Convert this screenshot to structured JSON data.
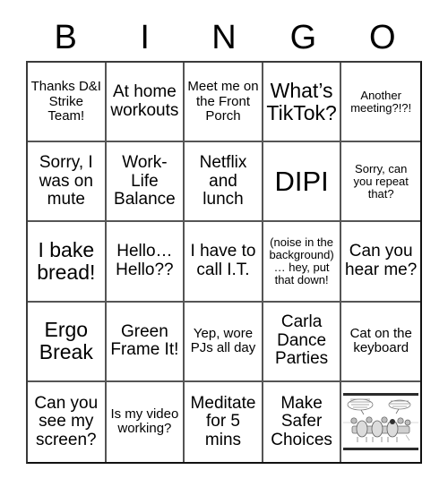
{
  "card": {
    "title": "BINGO",
    "header_letters": [
      "B",
      "I",
      "N",
      "G",
      "O"
    ],
    "grid_size": "5x5",
    "colors": {
      "background": "#ffffff",
      "text": "#000000",
      "grid_line": "#555555",
      "grid_border": "#111111"
    },
    "cells": [
      {
        "id": "b1",
        "column": "B",
        "row": 1,
        "text": "Thanks D&I Strike Team!",
        "size": "sm",
        "type": "text"
      },
      {
        "id": "i1",
        "column": "I",
        "row": 1,
        "text": "At home workouts",
        "size": "md",
        "type": "text"
      },
      {
        "id": "n1",
        "column": "N",
        "row": 1,
        "text": "Meet me on the Front Porch",
        "size": "sm",
        "type": "text"
      },
      {
        "id": "g1",
        "column": "G",
        "row": 1,
        "text": "What’s TikTok?",
        "size": "lg",
        "type": "text"
      },
      {
        "id": "o1",
        "column": "O",
        "row": 1,
        "text": "Another meeting?!?!",
        "size": "xs",
        "type": "text"
      },
      {
        "id": "b2",
        "column": "B",
        "row": 2,
        "text": "Sorry, I was on mute",
        "size": "md",
        "type": "text"
      },
      {
        "id": "i2",
        "column": "I",
        "row": 2,
        "text": "Work-Life Balance",
        "size": "md",
        "type": "text"
      },
      {
        "id": "n2",
        "column": "N",
        "row": 2,
        "text": "Netflix and lunch",
        "size": "md",
        "type": "text"
      },
      {
        "id": "g2",
        "column": "G",
        "row": 2,
        "text": "DIPI",
        "size": "xl",
        "type": "text"
      },
      {
        "id": "o2",
        "column": "O",
        "row": 2,
        "text": "Sorry, can you repeat that?",
        "size": "xs",
        "type": "text"
      },
      {
        "id": "b3",
        "column": "B",
        "row": 3,
        "text": "I bake bread!",
        "size": "lg",
        "type": "text"
      },
      {
        "id": "i3",
        "column": "I",
        "row": 3,
        "text": "Hello… Hello??",
        "size": "md",
        "type": "text"
      },
      {
        "id": "n3",
        "column": "N",
        "row": 3,
        "text": "I have to call I.T.",
        "size": "md",
        "type": "text"
      },
      {
        "id": "g3",
        "column": "G",
        "row": 3,
        "text": "(noise in the background) … hey, put that down!",
        "size": "xs",
        "type": "text"
      },
      {
        "id": "o3",
        "column": "O",
        "row": 3,
        "text": "Can you hear me?",
        "size": "md",
        "type": "text"
      },
      {
        "id": "b4",
        "column": "B",
        "row": 4,
        "text": "Ergo Break",
        "size": "lg",
        "type": "text"
      },
      {
        "id": "i4",
        "column": "I",
        "row": 4,
        "text": "Green Frame It!",
        "size": "md",
        "type": "text"
      },
      {
        "id": "n4",
        "column": "N",
        "row": 4,
        "text": "Yep, wore PJs all day",
        "size": "sm",
        "type": "text"
      },
      {
        "id": "g4",
        "column": "G",
        "row": 4,
        "text": "Carla Dance Parties",
        "size": "md",
        "type": "text"
      },
      {
        "id": "o4",
        "column": "O",
        "row": 4,
        "text": "Cat on the keyboard",
        "size": "sm",
        "type": "text"
      },
      {
        "id": "b5",
        "column": "B",
        "row": 5,
        "text": "Can you see my screen?",
        "size": "md",
        "type": "text"
      },
      {
        "id": "i5",
        "column": "I",
        "row": 5,
        "text": "Is my video working?",
        "size": "sm",
        "type": "text"
      },
      {
        "id": "n5",
        "column": "N",
        "row": 5,
        "text": "Meditate for 5 mins",
        "size": "md",
        "type": "text"
      },
      {
        "id": "g5",
        "column": "G",
        "row": 5,
        "text": "Make Safer Choices",
        "size": "md",
        "type": "text"
      },
      {
        "id": "o5",
        "column": "O",
        "row": 5,
        "text": "",
        "size": "sm",
        "type": "image",
        "image_name": "meeting-cartoon-thumbnail"
      }
    ]
  }
}
